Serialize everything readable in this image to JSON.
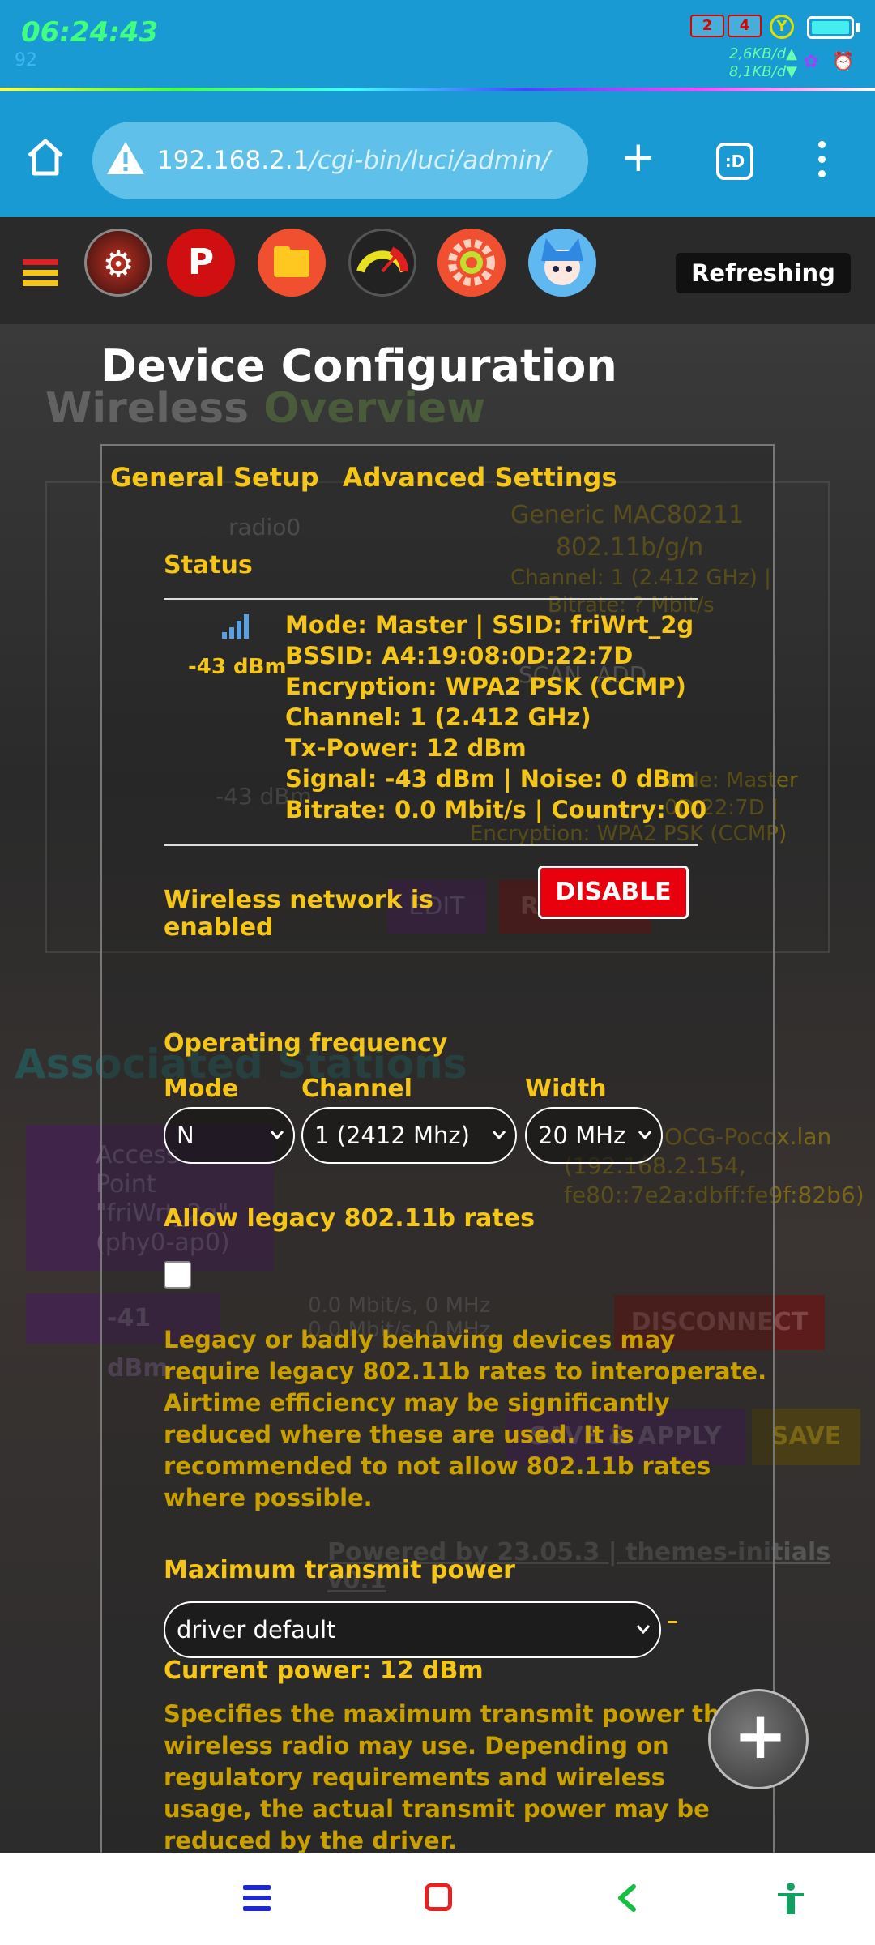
{
  "status_bar": {
    "time": "06:24:43",
    "sub": "92",
    "sim1": "2",
    "sim2": "4",
    "net_icon": "Y",
    "up_rate": "2,6KB/d▲",
    "down_rate": "8,1KB/d▼",
    "icons": [
      "signal-icon",
      "data-icon",
      "battery-icon",
      "alarm-icon"
    ]
  },
  "browser": {
    "url_host": "192.168.2.1",
    "url_path": "/cgi-bin/luci/admin/",
    "tabs_label": ":D"
  },
  "app_header": {
    "refresh_label": "Refreshing"
  },
  "background": {
    "title_a": "Wireless ",
    "title_b": "Overview",
    "radio": "radio0",
    "device_name": "Generic MAC80211",
    "device_std": "802.11b/g/n",
    "device_channel": "Channel: 1 (2.412 GHz) |",
    "device_bitrate": "Bitrate: ? Mbit/s",
    "signal": "-43 dBm",
    "mode_line": "Mode: Master",
    "bssid_frag": "0D:22:7D |",
    "enc_line": "Encryption: WPA2 PSK (CCMP)",
    "scan_btn": "SCAN",
    "add_btn": "ADD",
    "edit_btn": "EDIT",
    "remove_btn_frag": "R",
    "assoc_title": "Associated Stations",
    "ap_line1": "Access",
    "ap_line2": "Point",
    "ap_line3": "\"friWrt_2g\"",
    "ap_line4": "(phy0-ap0)",
    "client_host": "OCG-Pocox.lan",
    "client_ip4": "(192.168.2.154,",
    "client_ip6": "fe80::7e2a:dbff:fe9f:82b6)",
    "client_signal": "-41 dBm",
    "rate1": "0.0 Mbit/s, 0 MHz",
    "rate2": "0.0 Mbit/s, 0 MHz",
    "disconnect_btn": "DISCONNECT",
    "save_apply_btn": "SAVE & APPLY",
    "save_btn": "SAVE",
    "powered_by": "Powered by 23.05.3 | themes-initials v0.1"
  },
  "dialog": {
    "title": "Device Configuration",
    "tabs": [
      "General Setup",
      "Advanced Settings"
    ],
    "status_label": "Status",
    "signal_value": "-43 dBm",
    "status_lines": [
      "Mode: Master | SSID: friWrt_2g",
      "BSSID: A4:19:08:0D:22:7D",
      "Encryption: WPA2 PSK (CCMP)",
      "Channel: 1 (2.412 GHz)",
      "Tx-Power: 12 dBm",
      "Signal: -43 dBm | Noise: 0 dBm",
      "Bitrate: 0.0 Mbit/s | Country: 00"
    ],
    "enabled_line1": "Wireless network is",
    "enabled_line2": "enabled",
    "disable_btn": "DISABLE",
    "op_freq_label": "Operating frequency",
    "mode_label": "Mode",
    "channel_label": "Channel",
    "width_label": "Width",
    "mode_value": "N",
    "channel_value": "1 (2412 Mhz)",
    "width_value": "20 MHz",
    "legacy_label": "Allow legacy 802.11b rates",
    "legacy_checked": false,
    "legacy_desc": [
      "Legacy or badly behaving devices may",
      "require legacy 802.11b rates to interoperate.",
      "Airtime efficiency may be significantly",
      "reduced where these are used. It is",
      "recommended to not allow 802.11b rates",
      "where possible."
    ],
    "tx_label": "Maximum transmit power",
    "tx_value": "driver default",
    "current_power": "Current power: 12 dBm",
    "tx_desc": [
      "Specifies the maximum transmit power the",
      "wireless radio may use. Depending on",
      "regulatory requirements and wireless",
      "usage, the actual transmit power may be",
      "reduced by the driver."
    ]
  },
  "colors": {
    "accent": "#f5c518",
    "danger": "#e8000c",
    "browser_bar": "#1a9ad2"
  }
}
